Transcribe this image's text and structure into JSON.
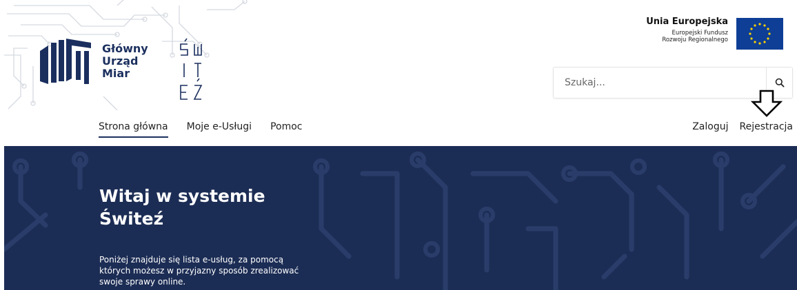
{
  "logo": {
    "line1": "Główny",
    "line2": "Urząd",
    "line3": "Miar"
  },
  "eu": {
    "title": "Unia Europejska",
    "sub_line1": "Europejski Fundusz",
    "sub_line2": "Rozwoju Regionalnego"
  },
  "search": {
    "placeholder": "Szukaj..."
  },
  "nav": {
    "left": [
      "Strona główna",
      "Moje e-Usługi",
      "Pomoc"
    ],
    "right": [
      "Zaloguj",
      "Rejestracja"
    ],
    "active_index": 0
  },
  "hero": {
    "title_line1": "Witaj w systemie",
    "title_line2": "Świteź",
    "description": "Poniżej znajduje się lista e-usług, za pomocą których możesz w przyjazny sposób zrealizować swoje sprawy online."
  },
  "colors": {
    "brand_navy": "#1c2d55",
    "eu_blue": "#0e3e96",
    "eu_star": "#ffd200"
  }
}
